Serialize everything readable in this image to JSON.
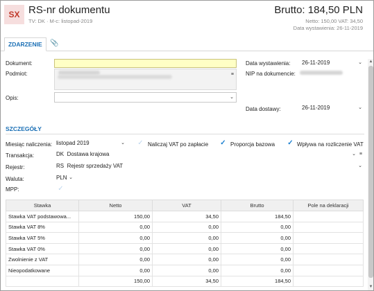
{
  "header": {
    "logo": "SX",
    "title": "RS-nr dokumentu",
    "subtitle": "TV: DK  ·  M-c: listopad-2019",
    "brutto": "Brutto: 184,50 PLN",
    "netto_vat": "Netto: 150,00 VAT: 34,50",
    "data_wystawienia": "Data wystawienia: 26-11-2019"
  },
  "tabs": {
    "zdarzenie": "ZDARZENIE",
    "attachment_icon": "paperclip-icon"
  },
  "form": {
    "dokument_label": "Dokument:",
    "dokument_value": "",
    "podmiot_label": "Podmiot:",
    "opis_label": "Opis:",
    "opis_value": "",
    "data_wystawienia_label": "Data wystawienia:",
    "data_wystawienia_value": "26-11-2019",
    "nip_label": "NIP na dokumencie:",
    "data_dostawy_label": "Data dostawy:",
    "data_dostawy_value": "26-11-2019"
  },
  "szczegoly": {
    "title": "SZCZEGÓŁY",
    "miesiac_label": "Miesiąc naliczenia:",
    "miesiac_value": "listopad 2019",
    "nalicz_vat_label": "Naliczaj VAT po zapłacie",
    "nalicz_vat_checked": false,
    "proporcja_label": "Proporcja bazowa",
    "proporcja_checked": true,
    "wplywa_label": "Wpływa na rozliczenie VAT",
    "wplywa_checked": true,
    "transakcja_label": "Transakcja:",
    "transakcja_code": "DK",
    "transakcja_value": "Dostawa krajowa",
    "rejestr_label": "Rejestr:",
    "rejestr_code": "RS",
    "rejestr_value": "Rejestr sprzedaży VAT",
    "waluta_label": "Waluta:",
    "waluta_value": "PLN",
    "mpp_label": "MPP:",
    "mpp_checked": false
  },
  "table": {
    "headers": [
      "Stawka",
      "Netto",
      "VAT",
      "Brutto",
      "Pole na deklaracji"
    ],
    "rows": [
      [
        "Stawka VAT podstawowa...",
        "150,00",
        "34,50",
        "184,50",
        ""
      ],
      [
        "Stawka VAT 8%",
        "0,00",
        "0,00",
        "0,00",
        ""
      ],
      [
        "Stawka VAT 5%",
        "0,00",
        "0,00",
        "0,00",
        ""
      ],
      [
        "Stawka VAT 0%",
        "0,00",
        "0,00",
        "0,00",
        ""
      ],
      [
        "Zwolnienie z VAT",
        "0,00",
        "0,00",
        "0,00",
        ""
      ],
      [
        "Nieopodatkowane",
        "0,00",
        "0,00",
        "0,00",
        ""
      ]
    ],
    "totals": [
      "",
      "150,00",
      "34,50",
      "184,50",
      ""
    ]
  },
  "colors": {
    "accent": "#1a6fb5",
    "logo_bg": "#f6dede",
    "logo_fg": "#c0392b",
    "input_yellow": "#ffffc5"
  }
}
